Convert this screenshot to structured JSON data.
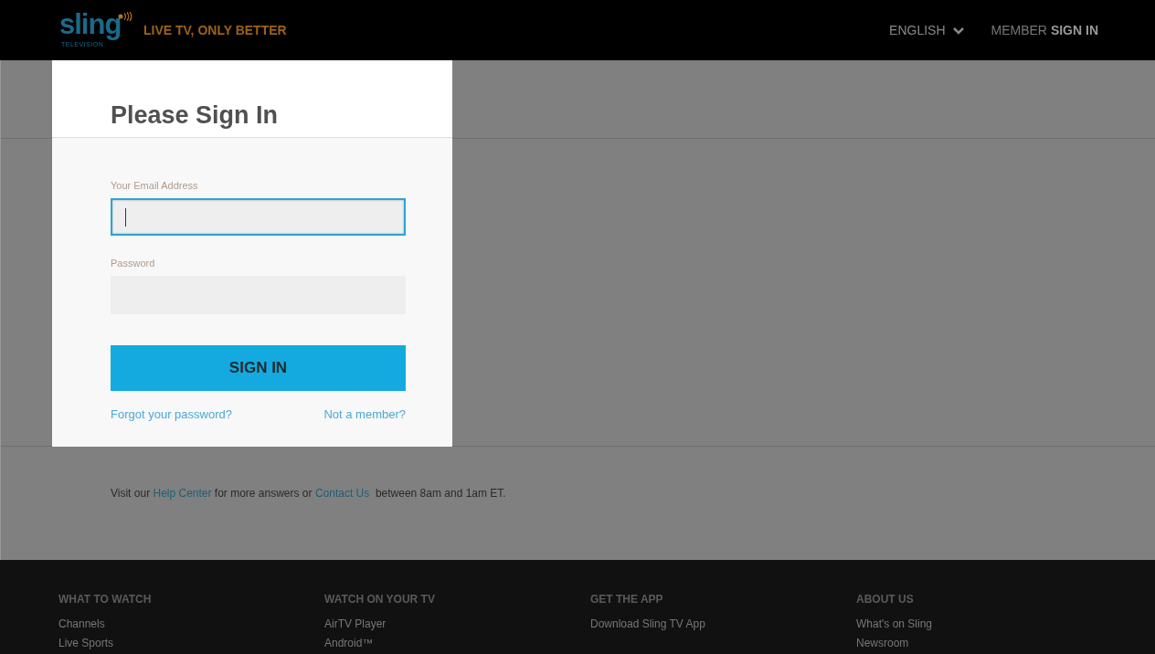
{
  "header": {
    "logo": {
      "word": "sling",
      "sub": "TELEVISION"
    },
    "tagline": "LIVE TV, ONLY BETTER",
    "language": "ENGLISH",
    "member": {
      "prefix": "MEMBER",
      "bold": "SIGN IN"
    }
  },
  "dialog": {
    "title": "Please Sign In",
    "fields": [
      {
        "label": "Your Email Address",
        "focused": true
      },
      {
        "label": "Password",
        "focused": false
      }
    ],
    "button": "SIGN IN",
    "links": [
      "Forgot your password?",
      "Not a member?"
    ]
  },
  "help": {
    "parts": [
      {
        "text": "Visit our ",
        "link": false
      },
      {
        "text": "Help Center",
        "link": true
      },
      {
        "text": " for more answers or ",
        "link": false
      },
      {
        "text": "Contact Us",
        "link": true
      },
      {
        "text": "  between 8am and 1am ET.",
        "link": false
      }
    ]
  },
  "footer": {
    "columns": [
      {
        "heading": "WHAT TO WATCH",
        "items": [
          "Channels",
          "Live Sports"
        ]
      },
      {
        "heading": "WATCH ON YOUR TV",
        "items": [
          "AirTV Player",
          "Android™"
        ]
      },
      {
        "heading": "GET THE APP",
        "items": [
          "Download Sling TV App"
        ]
      },
      {
        "heading": "ABOUT US",
        "items": [
          "What's on Sling",
          "Newsroom"
        ]
      }
    ]
  }
}
